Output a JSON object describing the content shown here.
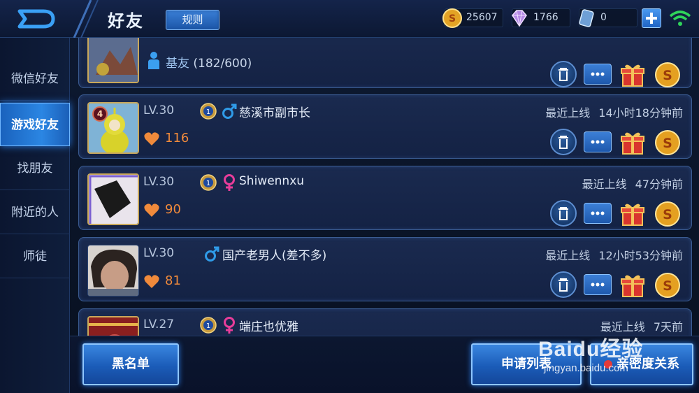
{
  "header": {
    "title": "好友",
    "rules_label": "规则",
    "gold": "25607",
    "diamonds": "1766",
    "vouchers": "0"
  },
  "sidebar": {
    "items": [
      {
        "label": "微信好友",
        "active": false
      },
      {
        "label": "游戏好友",
        "active": true
      },
      {
        "label": "找朋友",
        "active": false
      },
      {
        "label": "附近的人",
        "active": false
      },
      {
        "label": "师徒",
        "active": false
      }
    ]
  },
  "friends_summary": {
    "label": "基友",
    "count": "(182/600)"
  },
  "friends": [
    {
      "level": "LV.30",
      "rank": "1",
      "gender": "male",
      "name": "慈溪市副市长",
      "intimacy": "116",
      "online_label": "最近上线",
      "online_time": "14小时18分钟前",
      "badge": "4"
    },
    {
      "level": "LV.30",
      "rank": "1",
      "gender": "female",
      "name": "Shiwennxu",
      "intimacy": "90",
      "online_label": "最近上线",
      "online_time": "47分钟前"
    },
    {
      "level": "LV.30",
      "rank": "",
      "gender": "male",
      "name": "国产老男人(差不多)",
      "intimacy": "81",
      "online_label": "最近上线",
      "online_time": "12小时53分钟前"
    },
    {
      "level": "LV.27",
      "rank": "1",
      "gender": "female",
      "name": "端庄也优雅",
      "intimacy": "",
      "online_label": "最近上线",
      "online_time": "7天前"
    }
  ],
  "bottom": {
    "blacklist_label": "黑名单",
    "requests_label": "申请列表",
    "intimacy_label": "亲密度关系"
  },
  "watermark": {
    "brand": "Baidu经验",
    "url": "jingyan.baidu.com"
  },
  "colors": {
    "accent": "#2b86e3",
    "intimacy": "#f08a3b",
    "male": "#2f9be8",
    "female": "#e83d9a"
  }
}
